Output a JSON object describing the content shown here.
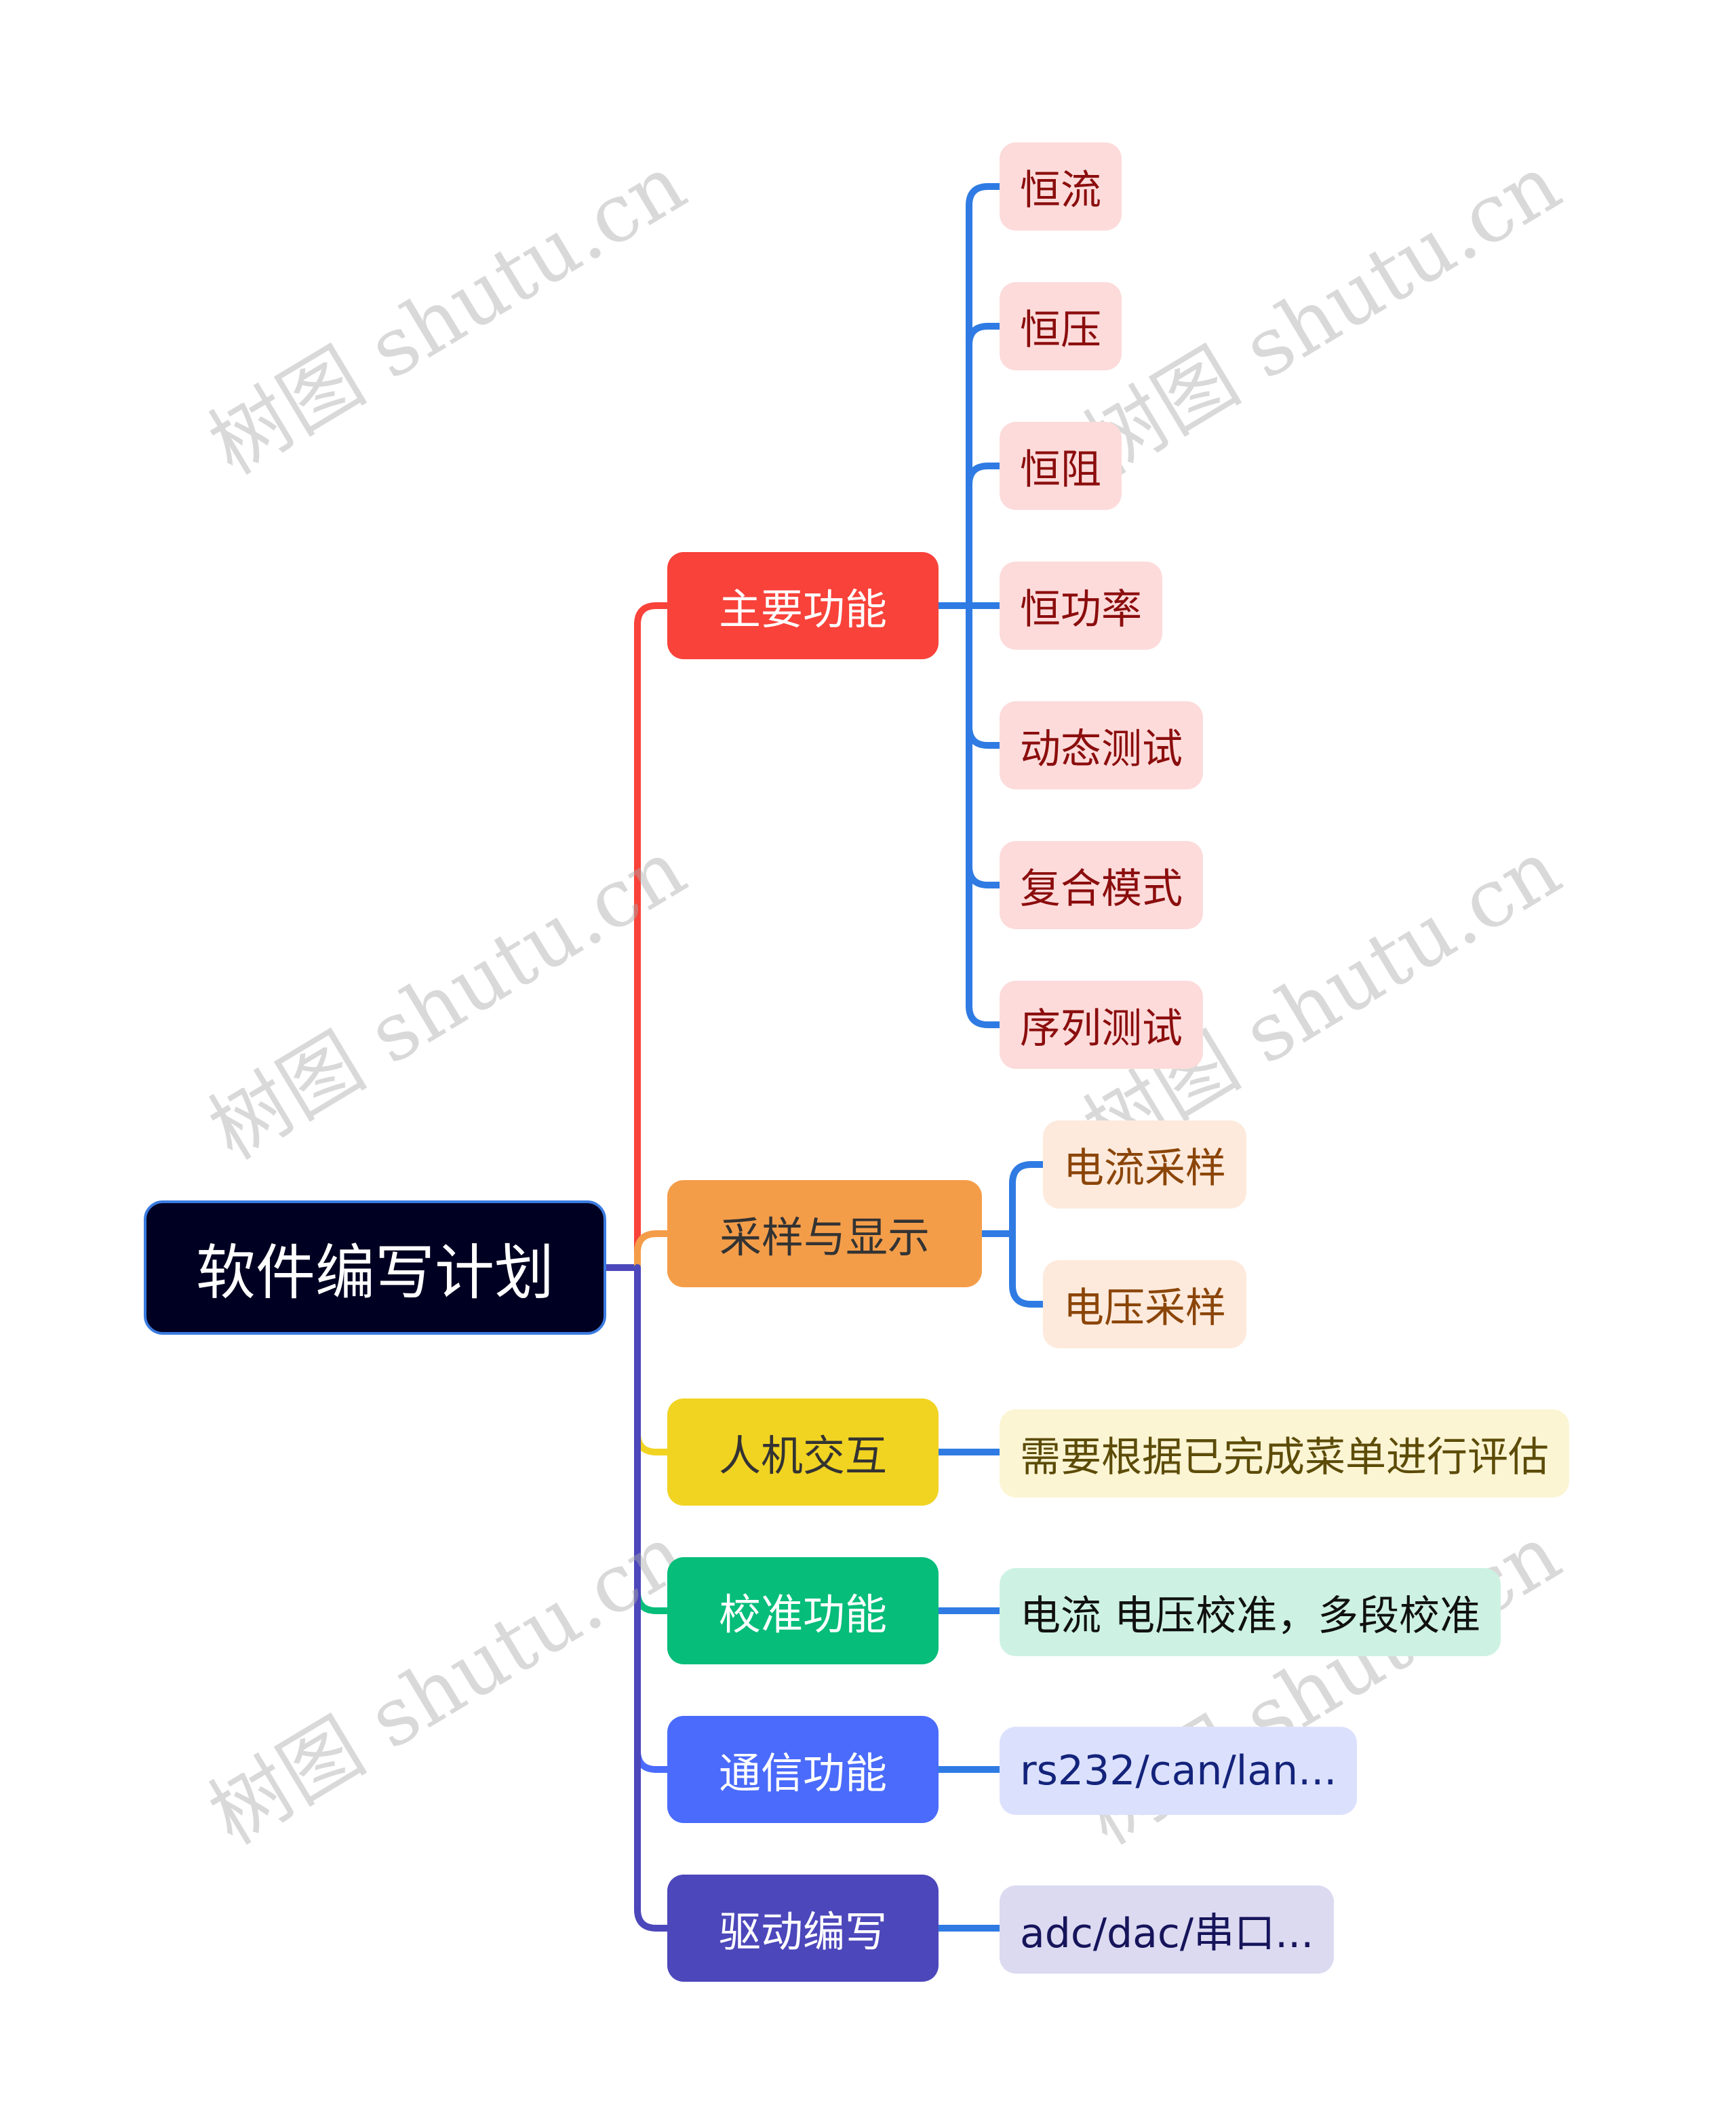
{
  "root": {
    "label": "软件编写计划",
    "color": "#000022",
    "border": "#3b7be0"
  },
  "branches": [
    {
      "label": "主要功能",
      "bg": "#f8423a",
      "fg": "#ffffff",
      "line": "#f8423a",
      "children": [
        {
          "label": "恒流"
        },
        {
          "label": "恒压"
        },
        {
          "label": "恒阻"
        },
        {
          "label": "恒功率"
        },
        {
          "label": "动态测试"
        },
        {
          "label": "复合模式"
        },
        {
          "label": "序列测试"
        }
      ],
      "child_bg": "#fddbdb",
      "child_fg": "#8b0d0d"
    },
    {
      "label": "采样与显示",
      "bg": "#f49d49",
      "fg": "#333333",
      "line": "#f49d49",
      "children": [
        {
          "label": "电流采样"
        },
        {
          "label": "电压采样"
        }
      ],
      "child_bg": "#fdeadc",
      "child_fg": "#8b4508"
    },
    {
      "label": "人机交互",
      "bg": "#f1d322",
      "fg": "#333333",
      "line": "#f1d322",
      "children": [
        {
          "label": "需要根据已完成菜单进行评估"
        }
      ],
      "child_bg": "#fcf5d4",
      "child_fg": "#5c4c08"
    },
    {
      "label": "校准功能",
      "bg": "#06bd7a",
      "fg": "#ffffff",
      "line": "#06bd7a",
      "children": [
        {
          "label": "电流 电压校准，多段校准"
        }
      ],
      "child_bg": "#cdf2e4",
      "child_fg": "#111111"
    },
    {
      "label": "通信功能",
      "bg": "#4a6bfb",
      "fg": "#ffffff",
      "line": "#4a6bfb",
      "children": [
        {
          "label": "rs232/can/lan..."
        }
      ],
      "child_bg": "#dbe1fd",
      "child_fg": "#14237a"
    },
    {
      "label": "驱动编写",
      "bg": "#4c47bb",
      "fg": "#ffffff",
      "line": "#4c47bb",
      "children": [
        {
          "label": "adc/dac/串口..."
        }
      ],
      "child_bg": "#dbdaf1",
      "child_fg": "#16145a"
    }
  ],
  "sub_link_color": "#2f7be3",
  "watermark": {
    "text": "树图 shutu.cn"
  }
}
